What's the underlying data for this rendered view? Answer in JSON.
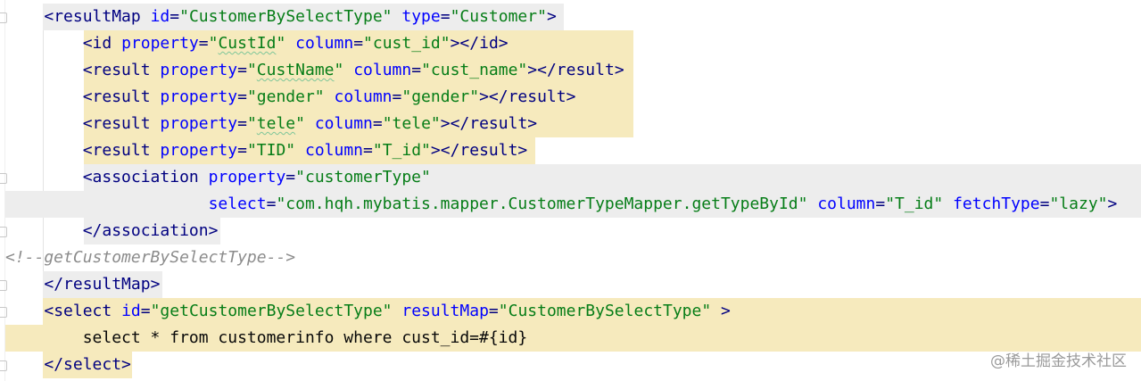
{
  "editor": {
    "lines": [
      {
        "highlight": "gray",
        "tokens": [
          {
            "t": "    ",
            "c": "plain"
          },
          {
            "t": "<resultMap ",
            "c": "tag"
          },
          {
            "t": "id",
            "c": "attr"
          },
          {
            "t": "=",
            "c": "tag"
          },
          {
            "t": "\"CustomerBySelectType\"",
            "c": "val"
          },
          {
            "t": " ",
            "c": "plain"
          },
          {
            "t": "type",
            "c": "attr"
          },
          {
            "t": "=",
            "c": "tag"
          },
          {
            "t": "\"Customer\"",
            "c": "val"
          },
          {
            "t": ">",
            "c": "tag"
          }
        ]
      },
      {
        "highlight": "yellow",
        "tokens": [
          {
            "t": "        ",
            "c": "plain"
          },
          {
            "t": "<id ",
            "c": "tag"
          },
          {
            "t": "property",
            "c": "attr"
          },
          {
            "t": "=",
            "c": "tag"
          },
          {
            "t": "\"",
            "c": "val"
          },
          {
            "t": "CustId",
            "c": "val typo"
          },
          {
            "t": "\"",
            "c": "val"
          },
          {
            "t": " ",
            "c": "plain"
          },
          {
            "t": "column",
            "c": "attr"
          },
          {
            "t": "=",
            "c": "tag"
          },
          {
            "t": "\"cust_id\"",
            "c": "val"
          },
          {
            "t": "></id>",
            "c": "tag"
          }
        ]
      },
      {
        "highlight": "yellow",
        "tokens": [
          {
            "t": "        ",
            "c": "plain"
          },
          {
            "t": "<result ",
            "c": "tag"
          },
          {
            "t": "property",
            "c": "attr"
          },
          {
            "t": "=",
            "c": "tag"
          },
          {
            "t": "\"",
            "c": "val"
          },
          {
            "t": "CustName",
            "c": "val typo"
          },
          {
            "t": "\"",
            "c": "val"
          },
          {
            "t": " ",
            "c": "plain"
          },
          {
            "t": "column",
            "c": "attr"
          },
          {
            "t": "=",
            "c": "tag"
          },
          {
            "t": "\"cust_name\"",
            "c": "val"
          },
          {
            "t": "></result>",
            "c": "tag"
          }
        ]
      },
      {
        "highlight": "yellow",
        "tokens": [
          {
            "t": "        ",
            "c": "plain"
          },
          {
            "t": "<result ",
            "c": "tag"
          },
          {
            "t": "property",
            "c": "attr"
          },
          {
            "t": "=",
            "c": "tag"
          },
          {
            "t": "\"gender\"",
            "c": "val"
          },
          {
            "t": " ",
            "c": "plain"
          },
          {
            "t": "column",
            "c": "attr"
          },
          {
            "t": "=",
            "c": "tag"
          },
          {
            "t": "\"gender\"",
            "c": "val"
          },
          {
            "t": "></result>",
            "c": "tag"
          }
        ]
      },
      {
        "highlight": "yellow",
        "tokens": [
          {
            "t": "        ",
            "c": "plain"
          },
          {
            "t": "<result ",
            "c": "tag"
          },
          {
            "t": "property",
            "c": "attr"
          },
          {
            "t": "=",
            "c": "tag"
          },
          {
            "t": "\"",
            "c": "val"
          },
          {
            "t": "tele",
            "c": "val typo"
          },
          {
            "t": "\"",
            "c": "val"
          },
          {
            "t": " ",
            "c": "plain"
          },
          {
            "t": "column",
            "c": "attr"
          },
          {
            "t": "=",
            "c": "tag"
          },
          {
            "t": "\"tele\"",
            "c": "val"
          },
          {
            "t": "></result>",
            "c": "tag"
          }
        ]
      },
      {
        "highlight": "yellow",
        "tokens": [
          {
            "t": "        ",
            "c": "plain"
          },
          {
            "t": "<result ",
            "c": "tag"
          },
          {
            "t": "property",
            "c": "attr"
          },
          {
            "t": "=",
            "c": "tag"
          },
          {
            "t": "\"TID\"",
            "c": "val"
          },
          {
            "t": " ",
            "c": "plain"
          },
          {
            "t": "column",
            "c": "attr"
          },
          {
            "t": "=",
            "c": "tag"
          },
          {
            "t": "\"T_id\"",
            "c": "val"
          },
          {
            "t": "></result>",
            "c": "tag"
          }
        ]
      },
      {
        "highlight": "gray",
        "tokens": [
          {
            "t": "        ",
            "c": "plain"
          },
          {
            "t": "<association ",
            "c": "tag"
          },
          {
            "t": "property",
            "c": "attr"
          },
          {
            "t": "=",
            "c": "tag"
          },
          {
            "t": "\"customerType\"",
            "c": "val"
          }
        ]
      },
      {
        "highlight": "gray",
        "tokens": [
          {
            "t": "                     ",
            "c": "plain"
          },
          {
            "t": "select",
            "c": "attr"
          },
          {
            "t": "=",
            "c": "tag"
          },
          {
            "t": "\"com.hqh.mybatis.mapper.CustomerTypeMapper.getTypeById\"",
            "c": "val"
          },
          {
            "t": " ",
            "c": "plain"
          },
          {
            "t": "column",
            "c": "attr"
          },
          {
            "t": "=",
            "c": "tag"
          },
          {
            "t": "\"T_id\"",
            "c": "val"
          },
          {
            "t": " ",
            "c": "plain"
          },
          {
            "t": "fetchType",
            "c": "attr"
          },
          {
            "t": "=",
            "c": "tag"
          },
          {
            "t": "\"lazy\"",
            "c": "val"
          },
          {
            "t": ">",
            "c": "tag"
          }
        ]
      },
      {
        "highlight": "gray",
        "tokens": [
          {
            "t": "        ",
            "c": "plain"
          },
          {
            "t": "</association>",
            "c": "tag"
          }
        ]
      },
      {
        "highlight": "none",
        "tokens": [
          {
            "t": "<!--getCustomerBySelectType-->",
            "c": "comment"
          }
        ]
      },
      {
        "highlight": "gray",
        "tokens": [
          {
            "t": "    ",
            "c": "plain"
          },
          {
            "t": "</resultMap>",
            "c": "tag"
          }
        ]
      },
      {
        "highlight": "yellow",
        "tokens": [
          {
            "t": "    ",
            "c": "plain"
          },
          {
            "t": "<select ",
            "c": "tag"
          },
          {
            "t": "id",
            "c": "attr"
          },
          {
            "t": "=",
            "c": "tag"
          },
          {
            "t": "\"getCustomerBySelectType\"",
            "c": "val"
          },
          {
            "t": " ",
            "c": "plain"
          },
          {
            "t": "resultMap",
            "c": "attr"
          },
          {
            "t": "=",
            "c": "tag"
          },
          {
            "t": "\"CustomerBySelectType\"",
            "c": "val"
          },
          {
            "t": " >",
            "c": "tag"
          }
        ]
      },
      {
        "highlight": "yellow",
        "tokens": [
          {
            "t": "        select * from customerinfo where cust_id=#{id}",
            "c": "plain"
          }
        ]
      },
      {
        "highlight": "yellow",
        "tokens": [
          {
            "t": "    ",
            "c": "plain"
          },
          {
            "t": "</select>",
            "c": "tag"
          }
        ]
      }
    ]
  },
  "watermark": "@稀土掘金技术社区",
  "colors": {
    "tag": "#000080",
    "attribute": "#0000ff",
    "value": "#067d17",
    "comment": "#8c8c8c",
    "highlight_yellow": "#f6eabd",
    "highlight_gray": "#ededed"
  }
}
